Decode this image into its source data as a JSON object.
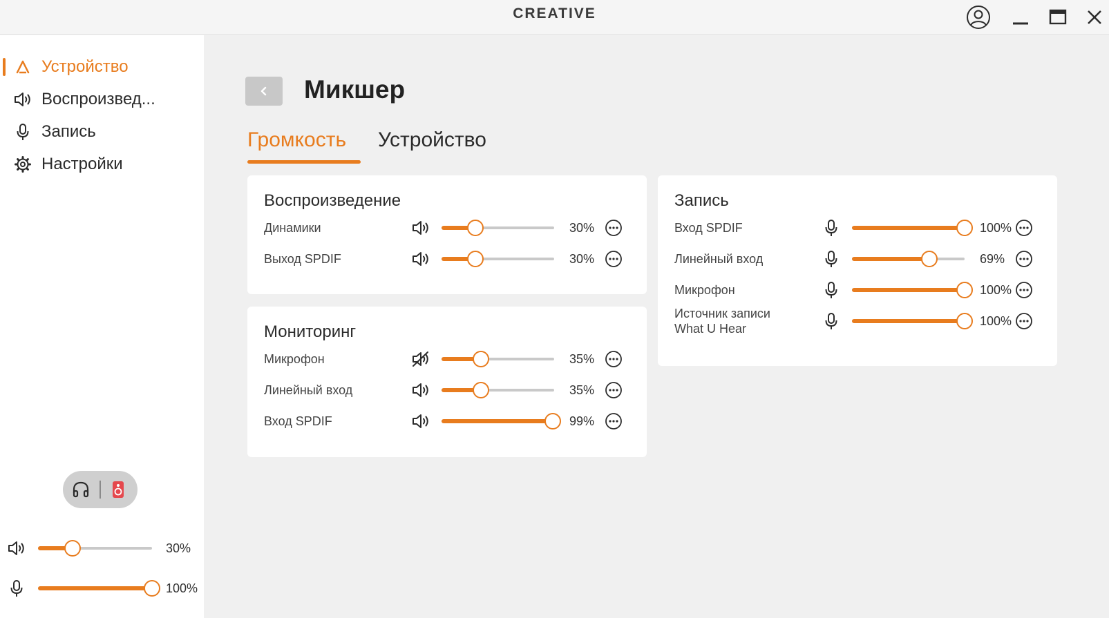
{
  "window": {
    "logo": "CREATIVE"
  },
  "sidebar": {
    "items": [
      {
        "label": "Устройство",
        "icon": "creative-device-icon",
        "active": true
      },
      {
        "label": "Воспроизвед...",
        "icon": "speaker-icon",
        "active": false
      },
      {
        "label": "Запись",
        "icon": "microphone-icon",
        "active": false
      },
      {
        "label": "Настройки",
        "icon": "gear-icon",
        "active": false
      }
    ],
    "output_toggle": {
      "options": [
        "headphones-icon",
        "speaker-box-icon"
      ],
      "selected": "speaker-box-icon"
    },
    "master_playback": {
      "icon": "speaker-icon",
      "value": 30,
      "value_label": "30%"
    },
    "master_record": {
      "icon": "microphone-icon",
      "value": 100,
      "value_label": "100%"
    }
  },
  "main": {
    "title": "Микшер",
    "tabs": [
      {
        "label": "Громкость",
        "active": true
      },
      {
        "label": "Устройство",
        "active": false
      }
    ],
    "playback": {
      "title": "Воспроизведение",
      "rows": [
        {
          "label": "Динамики",
          "icon": "speaker-icon",
          "value": 30,
          "value_label": "30%"
        },
        {
          "label": "Выход SPDIF",
          "icon": "speaker-icon",
          "value": 30,
          "value_label": "30%"
        }
      ]
    },
    "monitoring": {
      "title": "Мониторинг",
      "rows": [
        {
          "label": "Микрофон",
          "icon": "speaker-muted-icon",
          "value": 35,
          "value_label": "35%"
        },
        {
          "label": "Линейный вход",
          "icon": "speaker-icon",
          "value": 35,
          "value_label": "35%"
        },
        {
          "label": "Вход SPDIF",
          "icon": "speaker-icon",
          "value": 99,
          "value_label": "99%"
        }
      ]
    },
    "recording": {
      "title": "Запись",
      "rows": [
        {
          "label": "Вход SPDIF",
          "label2": "",
          "icon": "microphone-icon",
          "value": 100,
          "value_label": "100%"
        },
        {
          "label": "Линейный вход",
          "label2": "",
          "icon": "microphone-icon",
          "value": 69,
          "value_label": "69%"
        },
        {
          "label": "Микрофон",
          "label2": "",
          "icon": "microphone-icon",
          "value": 100,
          "value_label": "100%"
        },
        {
          "label": "Источник записи",
          "label2": "What U Hear",
          "icon": "microphone-icon",
          "value": 100,
          "value_label": "100%"
        }
      ]
    }
  },
  "colors": {
    "accent": "#e87c1e",
    "track": "#c9c9c9",
    "toggle_active": "#e5484d"
  }
}
